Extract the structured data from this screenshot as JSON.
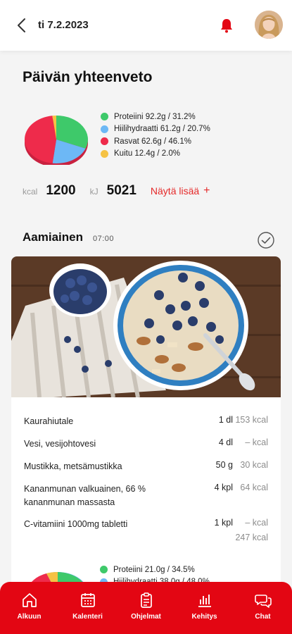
{
  "header": {
    "date": "ti 7.2.2023"
  },
  "summary": {
    "title": "Päivän yhteenveto",
    "legend": [
      {
        "label": "Proteiini 92.2g / 31.2%",
        "color": "#3ec96a",
        "percent": 31.2
      },
      {
        "label": "Hiilihydraatti 61.2g / 20.7%",
        "color": "#6db8f5",
        "percent": 20.7
      },
      {
        "label": "Rasvat 62.6g / 46.1%",
        "color": "#ee2b4b",
        "percent": 46.1
      },
      {
        "label": "Kuitu 12.4g / 2.0%",
        "color": "#f5c244",
        "percent": 2.0
      }
    ],
    "kcal_unit": "kcal",
    "kcal_value": "1200",
    "kj_unit": "kJ",
    "kj_value": "5021",
    "show_more": "Näytä lisää",
    "show_more_icon": "+"
  },
  "meal": {
    "title": "Aamiainen",
    "time": "07:00",
    "items": [
      {
        "name": "Kaurahiutale",
        "qty": "1 dl",
        "kcal": "153 kcal"
      },
      {
        "name": "Vesi, vesijohtovesi",
        "qty": "4 dl",
        "kcal": "– kcal"
      },
      {
        "name": "Mustikka, metsämustikka",
        "qty": "50 g",
        "kcal": "30 kcal"
      },
      {
        "name": "Kananmunan valkuainen, 66 % kananmunan massasta",
        "qty": "4 kpl",
        "kcal": "64 kcal"
      },
      {
        "name": "C-vitamiini 1000mg tabletti",
        "qty": "1 kpl",
        "kcal": "– kcal"
      }
    ],
    "total": "247 kcal",
    "legend": [
      {
        "label": "Proteiini 21.0g / 34.5%",
        "color": "#3ec96a"
      },
      {
        "label": "Hiilihydraatti 38.0g / 48.0%",
        "color": "#6db8f5"
      }
    ]
  },
  "nav": [
    {
      "label": "Alkuun",
      "icon": "home-icon"
    },
    {
      "label": "Kalenteri",
      "icon": "calendar-icon"
    },
    {
      "label": "Ohjelmat",
      "icon": "clipboard-icon"
    },
    {
      "label": "Kehitys",
      "icon": "chart-icon"
    },
    {
      "label": "Chat",
      "icon": "chat-icon"
    }
  ]
}
